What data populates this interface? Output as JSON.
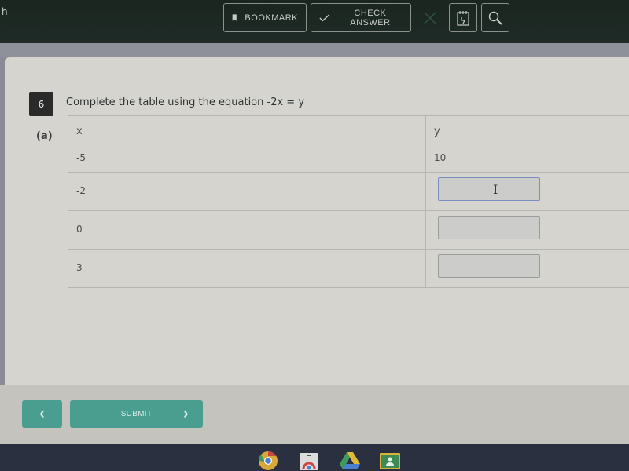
{
  "topbar": {
    "partial_text": "h",
    "bookmark_label": "BOOKMARK",
    "check_answer_label": "CHECK ANSWER",
    "icons": [
      "bookmark-icon",
      "checkmark-icon",
      "close-icon",
      "notepad-icon",
      "magnifier-icon"
    ]
  },
  "question": {
    "number": "6",
    "prompt": "Complete the table using the equation  -2x = y",
    "part": "(a)",
    "table": {
      "headers": [
        "x",
        "y"
      ],
      "rows": [
        {
          "x": "-5",
          "y": "10",
          "y_input": false
        },
        {
          "x": "-2",
          "y": "",
          "y_input": true
        },
        {
          "x": "0",
          "y": "",
          "y_input": true
        },
        {
          "x": "3",
          "y": "",
          "y_input": true
        }
      ]
    }
  },
  "navigation": {
    "prev_glyph": "‹",
    "submit_label": "SUBMIT",
    "next_glyph": "›"
  },
  "taskbar": {
    "apps": [
      "chrome",
      "chrome-web-store",
      "google-drive",
      "google-classroom"
    ]
  }
}
